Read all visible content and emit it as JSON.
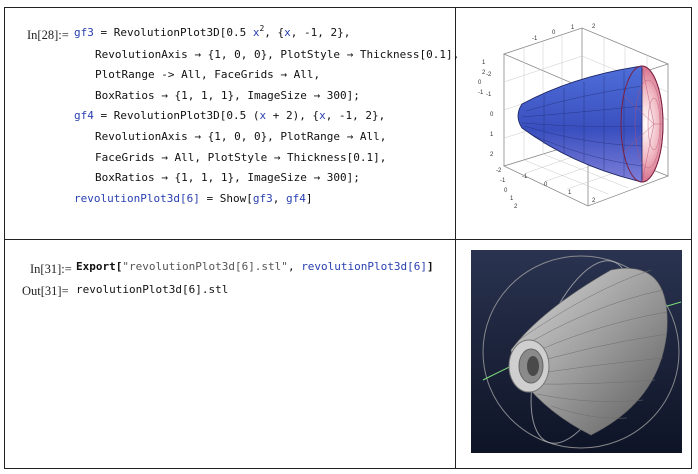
{
  "cell1": {
    "label": "In[28]:=",
    "lines": [
      {
        "indent": 0,
        "parts": [
          {
            "t": "gf3",
            "c": "kw"
          },
          {
            "t": " = RevolutionPlot3D[0.5 "
          },
          {
            "t": "x",
            "c": "kw"
          },
          {
            "t": "2",
            "c": "sup"
          },
          {
            "t": ", {"
          },
          {
            "t": "x",
            "c": "kw"
          },
          {
            "t": ", -1, 2},"
          }
        ]
      },
      {
        "indent": 1,
        "parts": [
          {
            "t": "RevolutionAxis → {1, 0, 0}, PlotStyle → Thickness[0.1],"
          }
        ]
      },
      {
        "indent": 1,
        "parts": [
          {
            "t": "PlotRange -> All, FaceGrids → All,"
          }
        ]
      },
      {
        "indent": 1,
        "parts": [
          {
            "t": "BoxRatios → {1, 1, 1}, ImageSize → 300];"
          }
        ]
      },
      {
        "indent": 0,
        "parts": [
          {
            "t": "gf4",
            "c": "kw"
          },
          {
            "t": " = RevolutionPlot3D[0.5 ("
          },
          {
            "t": "x",
            "c": "kw"
          },
          {
            "t": " + 2), {"
          },
          {
            "t": "x",
            "c": "kw"
          },
          {
            "t": ", -1, 2},"
          }
        ]
      },
      {
        "indent": 1,
        "parts": [
          {
            "t": "RevolutionAxis → {1, 0, 0}, PlotRange → All,"
          }
        ]
      },
      {
        "indent": 1,
        "parts": [
          {
            "t": "FaceGrids → All, PlotStyle → Thickness[0.1],"
          }
        ]
      },
      {
        "indent": 1,
        "parts": [
          {
            "t": "BoxRatios → {1, 1, 1}, ImageSize → 300];"
          }
        ]
      },
      {
        "indent": 0,
        "parts": [
          {
            "t": "revolutionPlot3d[6]",
            "c": "kw"
          },
          {
            "t": " = Show["
          },
          {
            "t": "gf3",
            "c": "kw"
          },
          {
            "t": ", "
          },
          {
            "t": "gf4",
            "c": "kw"
          },
          {
            "t": "]"
          }
        ]
      }
    ]
  },
  "cell2": {
    "in_label": "In[31]:=",
    "out_label": "Out[31]=",
    "in_line": [
      {
        "t": "Export[",
        "c": "b"
      },
      {
        "t": "\"revolutionPlot3d[6].stl\"",
        "c": "str"
      },
      {
        "t": ", "
      },
      {
        "t": "revolutionPlot3d[6]",
        "c": "kw"
      },
      {
        "t": "]",
        "c": "b"
      }
    ],
    "out_text": "revolutionPlot3d[6].stl"
  },
  "plot_axes": {
    "top_ticks": [
      "-1",
      "0",
      "1",
      "2"
    ],
    "left_ticks": [
      "-2",
      "-1",
      "0",
      "1",
      "2"
    ],
    "side_ticks": [
      "2",
      "1",
      "0",
      "-1"
    ],
    "bottom_ticks": [
      "-1",
      "0",
      "1",
      "2"
    ],
    "z_ticks": [
      "-2",
      "-1",
      "0",
      "1",
      "2"
    ]
  },
  "colors": {
    "keyword": "#2a40b0",
    "render_bg": "#1c2540",
    "mesh_gray": "#9a9a9a"
  }
}
